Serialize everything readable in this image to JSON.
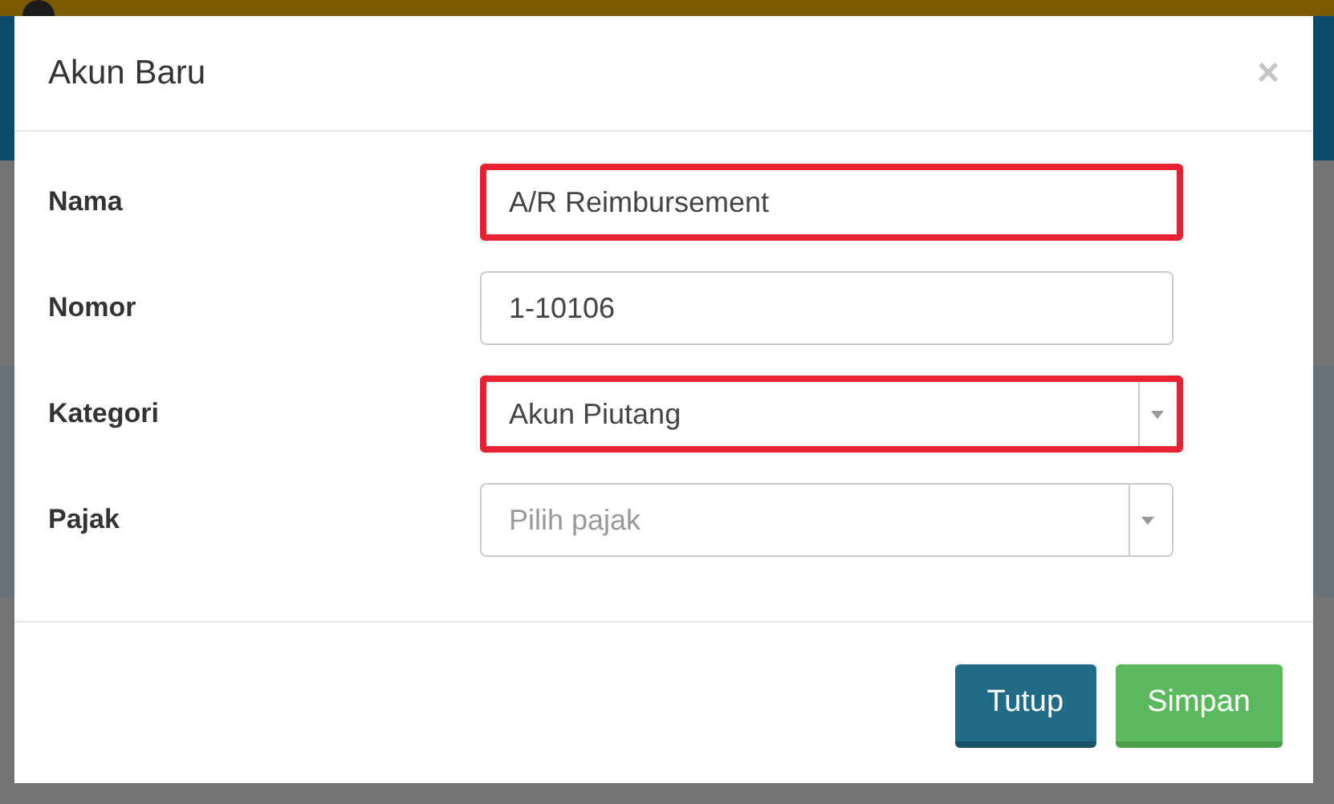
{
  "dialog": {
    "title": "Akun Baru",
    "close": "×",
    "fields": [
      {
        "label": "Nama",
        "kind": "text",
        "value": "A/R Reimbursement",
        "highlighted": true
      },
      {
        "label": "Nomor",
        "kind": "text",
        "value": "1-10106",
        "highlighted": false
      },
      {
        "label": "Kategori",
        "kind": "select",
        "value": "Akun Piutang",
        "highlighted": true
      },
      {
        "label": "Pajak",
        "kind": "select",
        "placeholder": "Pilih pajak",
        "highlighted": false
      }
    ],
    "buttons": [
      {
        "label": "Tutup",
        "kind": "secondary"
      },
      {
        "label": "Simpan",
        "kind": "primary"
      }
    ]
  }
}
